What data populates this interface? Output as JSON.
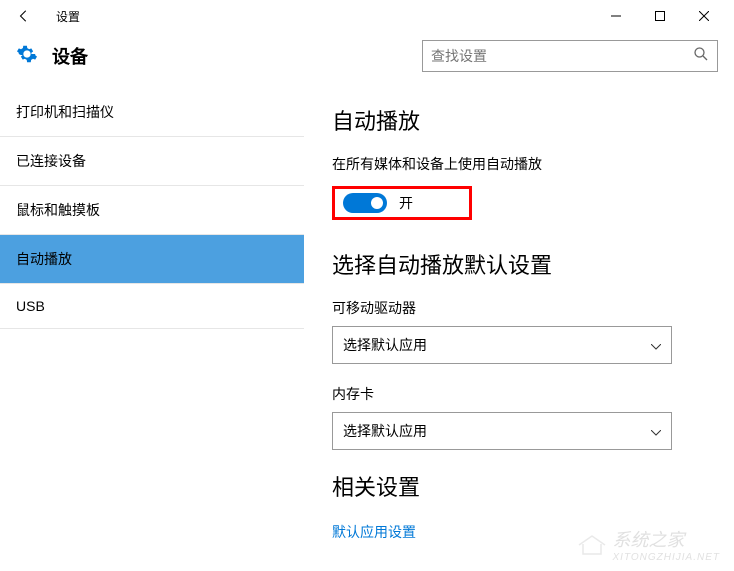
{
  "window": {
    "title": "设置"
  },
  "header": {
    "title": "设备",
    "search_placeholder": "查找设置"
  },
  "sidebar": {
    "items": [
      {
        "label": "打印机和扫描仪"
      },
      {
        "label": "已连接设备"
      },
      {
        "label": "鼠标和触摸板"
      },
      {
        "label": "自动播放"
      },
      {
        "label": "USB"
      }
    ]
  },
  "main": {
    "autoplay": {
      "title": "自动播放",
      "subtitle": "在所有媒体和设备上使用自动播放",
      "toggle_state": "开"
    },
    "defaults": {
      "title": "选择自动播放默认设置",
      "removable_label": "可移动驱动器",
      "removable_value": "选择默认应用",
      "memory_label": "内存卡",
      "memory_value": "选择默认应用"
    },
    "related": {
      "title": "相关设置",
      "link": "默认应用设置"
    }
  },
  "watermark": {
    "main": "系统之家",
    "sub": "XITONGZHIJIA.NET"
  }
}
